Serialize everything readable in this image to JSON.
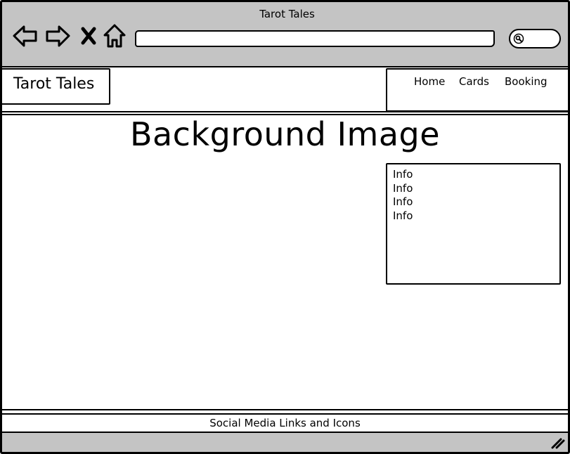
{
  "browser": {
    "title": "Tarot Tales",
    "address_value": "",
    "search_value": ""
  },
  "header": {
    "logo_text": "Tarot Tales",
    "nav": [
      "Home",
      "Cards",
      "Booking"
    ]
  },
  "hero": {
    "title": "Background Image"
  },
  "info_box": {
    "lines": [
      "Info",
      "Info",
      "Info",
      "Info"
    ]
  },
  "footer": {
    "text": "Social Media Links and Icons"
  },
  "colors": {
    "chrome": "#c4c4c4",
    "page": "#ffffff",
    "ink": "#000000"
  }
}
